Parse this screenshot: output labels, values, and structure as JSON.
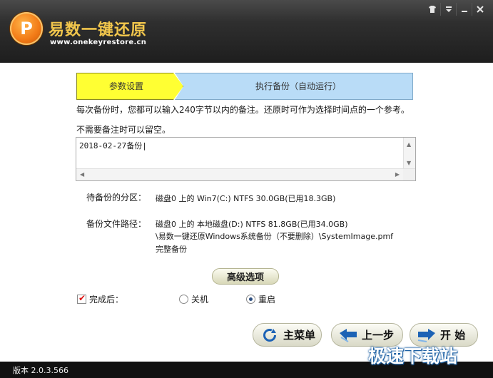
{
  "header": {
    "logo_glyph": "P",
    "title": "易数一键还原",
    "url": "www.onekeyrestore.cn",
    "controls": [
      "shirt-icon",
      "menu-icon",
      "minimize-icon",
      "close-icon"
    ]
  },
  "steps": {
    "step1": "参数设置",
    "step2": "执行备份（自动运行）"
  },
  "hints": {
    "line1": "每次备份时，您都可以输入240字节以内的备注。还原时可作为选择时间点的一个参考。",
    "line2": "不需要备注时可以留空。"
  },
  "note": {
    "value": "2018-02-27备份|"
  },
  "info": {
    "partition_label": "待备份的分区：",
    "partition_value": "磁盘0 上的 Win7(C:) NTFS 30.0GB(已用18.3GB)",
    "path_label": "备份文件路径：",
    "path_line1": "磁盘0 上的 本地磁盘(D:) NTFS 81.8GB(已用34.0GB)",
    "path_line2": "\\易数一键还原Windows系统备份（不要删除）\\SystemImage.pmf",
    "path_line3": "完整备份"
  },
  "advanced_button": "高级选项",
  "after": {
    "label": "完成后：",
    "checked": true,
    "options": [
      {
        "label": "关机",
        "selected": false
      },
      {
        "label": "重启",
        "selected": true
      }
    ]
  },
  "buttons": {
    "main_menu": "主菜单",
    "prev": "上一步",
    "start": "开 始"
  },
  "footer": {
    "version": "版本 2.0.3.566",
    "watermark": "极速下载站"
  },
  "colors": {
    "step1_bg": "#ffff33",
    "step2_bg": "#b9dcf7",
    "title_color": "#f1c64c",
    "header_bg": "#2f2f2f"
  }
}
